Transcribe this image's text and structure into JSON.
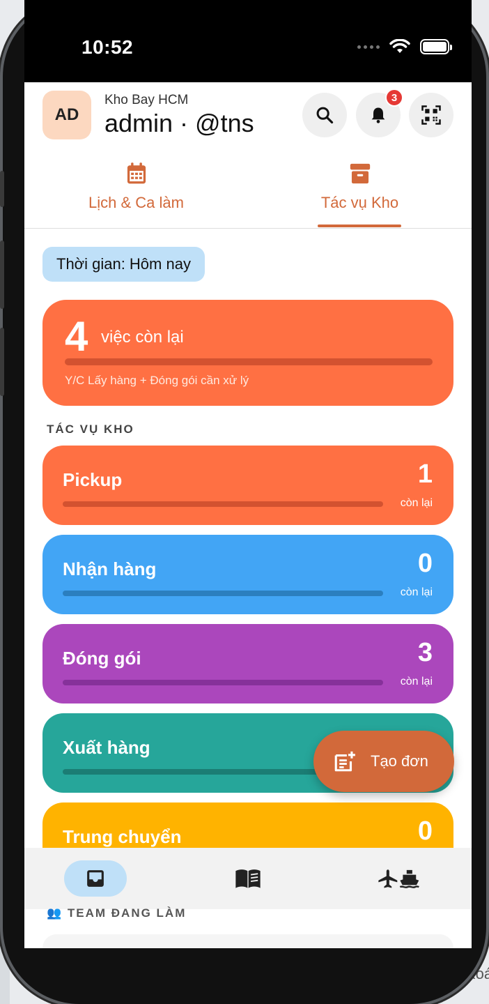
{
  "status_bar": {
    "time": "10:52"
  },
  "header": {
    "avatar_initials": "AD",
    "subtitle": "Kho Bay HCM",
    "username": "admin · @tns",
    "notification_count": "3"
  },
  "tabs": [
    {
      "label": "Lịch & Ca làm",
      "icon": "calendar-icon",
      "active": false
    },
    {
      "label": "Tác vụ Kho",
      "icon": "archive-box-icon",
      "active": true
    }
  ],
  "filter": {
    "label": "Thời gian: Hôm nay"
  },
  "summary": {
    "count": "4",
    "label": "việc còn lại",
    "description": "Y/C Lấy hàng + Đóng gói cần xử lý"
  },
  "section_title": "TÁC VỤ KHO",
  "tasks": [
    {
      "name": "Pickup",
      "count": "1",
      "sub": "còn lại",
      "color": "#ff7043",
      "bar_color": "#d35230"
    },
    {
      "name": "Nhận hàng",
      "count": "0",
      "sub": "còn lại",
      "color": "#42a5f5",
      "bar_color": "#2b7fbf"
    },
    {
      "name": "Đóng gói",
      "count": "3",
      "sub": "còn lại",
      "color": "#ab47bc",
      "bar_color": "#86319a"
    },
    {
      "name": "Xuất hàng",
      "count": "",
      "sub": "",
      "color": "#26a69a",
      "bar_color": "#1b7d74"
    },
    {
      "name": "Trung chuyển",
      "count": "0",
      "sub": "",
      "color": "#ffb300",
      "bar_color": "#d99500"
    }
  ],
  "fab": {
    "label": "Tạo đơn",
    "icon": "add-note-icon"
  },
  "team_section_title": "TEAM ĐANG LÀM",
  "bottom_nav": [
    {
      "icon": "inbox-icon",
      "active": true
    },
    {
      "icon": "book-icon",
      "active": false
    },
    {
      "icon": "plane-ship-icon",
      "active": false
    }
  ],
  "background_text": "Xoá"
}
